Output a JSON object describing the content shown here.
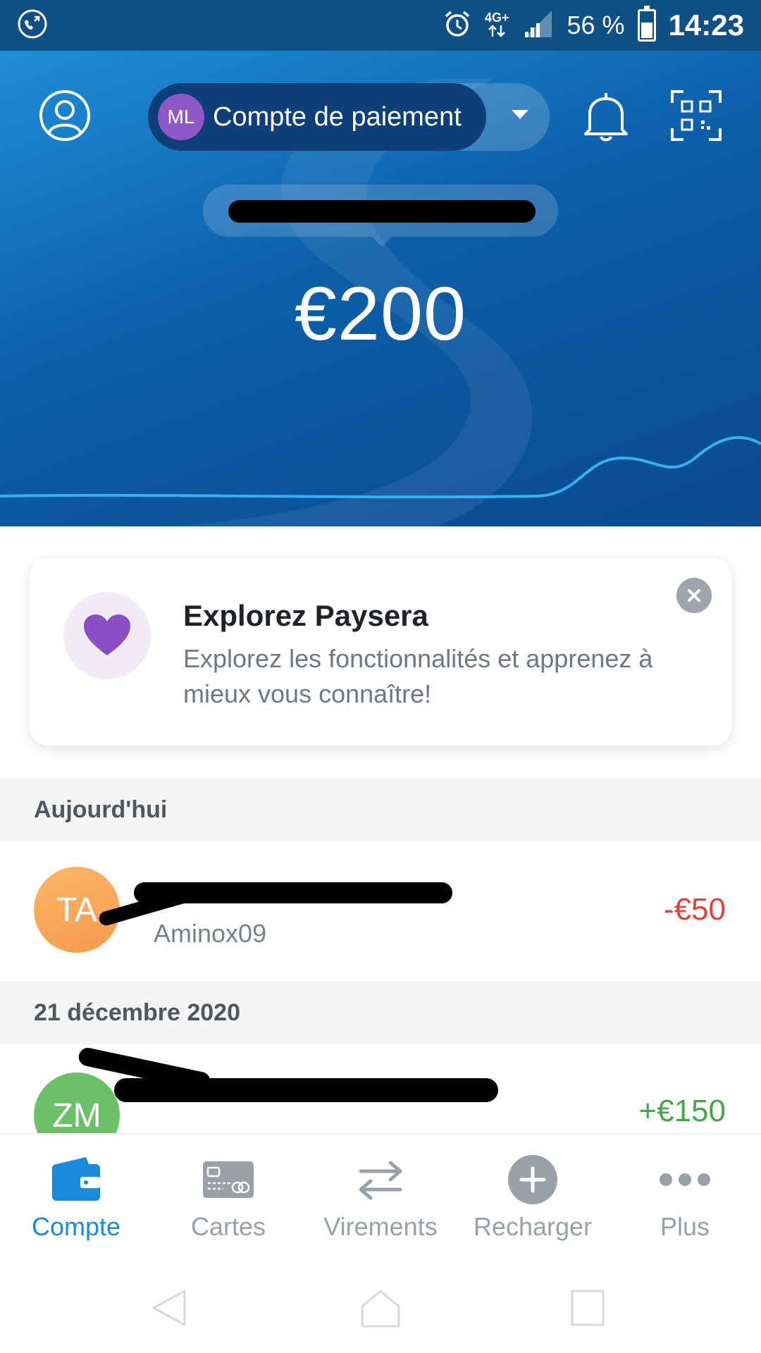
{
  "status_bar": {
    "network": "4G+",
    "battery_percent": "56 %",
    "battery_level": 0.56,
    "time": "14:23",
    "icons": [
      "call-icon",
      "alarm-icon",
      "data-arrows-icon",
      "signal-icon",
      "battery-icon"
    ]
  },
  "header": {
    "avatar_initials": "ML",
    "account_name": "Compte de paiement",
    "iban_text": "",
    "balance": "€200",
    "icons": [
      "profile-icon",
      "chevron-down-icon",
      "bell-icon",
      "qr-scan-icon"
    ],
    "colors": {
      "gradient_top": "#1e8ed6",
      "gradient_bottom": "#0a4a8f",
      "pill_dark": "#0f3f78",
      "avatar": "#8e59c7"
    }
  },
  "promo": {
    "title": "Explorez Paysera",
    "text": "Explorez les fonctionnalités et apprenez à mieux vous connaître!",
    "icons": [
      "heart-icon",
      "close-icon"
    ]
  },
  "transactions": {
    "groups": [
      {
        "date_label": "Aujourd'hui",
        "items": [
          {
            "initials": "TA",
            "title": "",
            "subtitle": "Aminox09",
            "amount": "-€50",
            "type": "debit",
            "avatar_color": "#f6a55a"
          }
        ]
      },
      {
        "date_label": "21 décembre 2020",
        "items": [
          {
            "initials": "ZM",
            "title": "",
            "subtitle": "",
            "amount": "+€150",
            "type": "credit",
            "avatar_color": "#6cc069"
          }
        ]
      }
    ]
  },
  "bottom_nav": {
    "items": [
      {
        "label": "Compte",
        "icon": "wallet-icon",
        "active": true
      },
      {
        "label": "Cartes",
        "icon": "card-icon",
        "active": false
      },
      {
        "label": "Virements",
        "icon": "transfer-icon",
        "active": false
      },
      {
        "label": "Recharger",
        "icon": "plus-icon",
        "active": false
      },
      {
        "label": "Plus",
        "icon": "more-icon",
        "active": false
      }
    ],
    "colors": {
      "active": "#1a8bdc",
      "inactive": "#9aa0a7"
    }
  },
  "system_nav": {
    "icons": [
      "back-icon",
      "home-icon",
      "recents-icon"
    ]
  }
}
